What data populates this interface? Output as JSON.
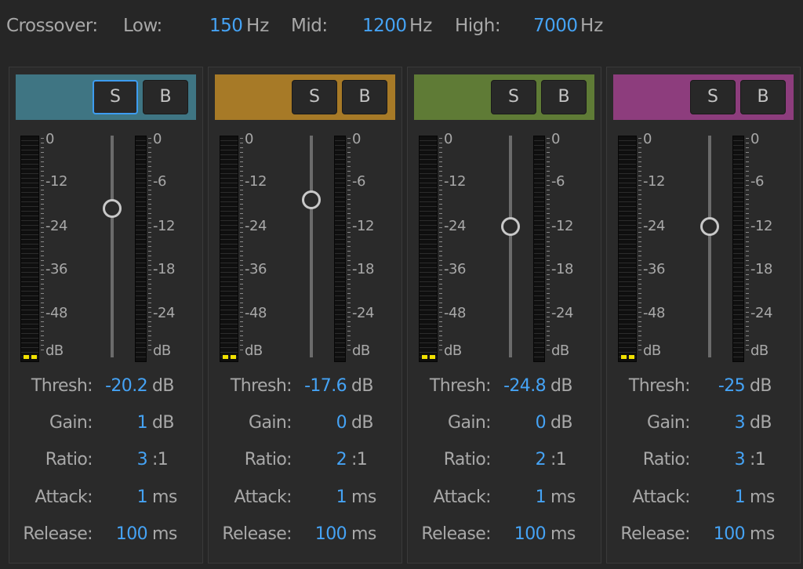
{
  "crossover": {
    "label": "Crossover:",
    "low_label": "Low:",
    "low_value": "150",
    "mid_label": "Mid:",
    "mid_value": "1200",
    "high_label": "High:",
    "high_value": "7000",
    "unit": "Hz"
  },
  "colors": {
    "accent": "#45a3f5",
    "meter_peak": "#f0e000"
  },
  "buttons": {
    "solo": "S",
    "bypass": "B"
  },
  "meter_scale": {
    "input": [
      "0",
      "-12",
      "-24",
      "-36",
      "-48",
      "dB"
    ],
    "gain_reduction": [
      "0",
      "-6",
      "-12",
      "-18",
      "-24",
      "dB"
    ]
  },
  "param_labels": {
    "thresh": "Thresh:",
    "gain": "Gain:",
    "ratio": "Ratio:",
    "attack": "Attack:",
    "release": "Release:"
  },
  "units": {
    "db": "dB",
    "ratio": ":1",
    "ms": "ms"
  },
  "bands": [
    {
      "color": "#3f7583",
      "solo_active": true,
      "threshold_fraction": 0.33,
      "thresh": "-20.2",
      "gain": "1",
      "ratio": "3",
      "attack": "1",
      "release": "100"
    },
    {
      "color": "#a77a27",
      "solo_active": false,
      "threshold_fraction": 0.29,
      "thresh": "-17.6",
      "gain": "0",
      "ratio": "2",
      "attack": "1",
      "release": "100"
    },
    {
      "color": "#5f7b36",
      "solo_active": false,
      "threshold_fraction": 0.41,
      "thresh": "-24.8",
      "gain": "0",
      "ratio": "2",
      "attack": "1",
      "release": "100"
    },
    {
      "color": "#8d3d7d",
      "solo_active": false,
      "threshold_fraction": 0.41,
      "thresh": "-25",
      "gain": "3",
      "ratio": "3",
      "attack": "1",
      "release": "100"
    }
  ]
}
